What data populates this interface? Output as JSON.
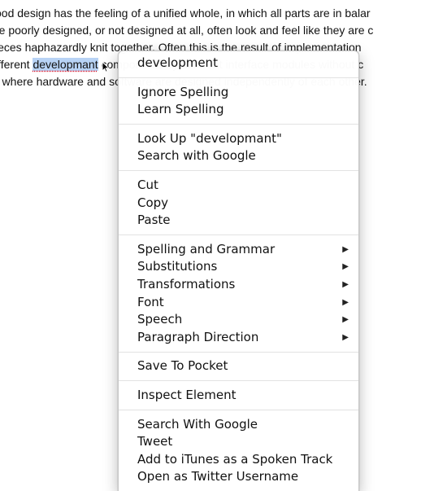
{
  "document": {
    "lines": [
      {
        "before": "ood design has the feeling of a unified whole, in which all parts are in balar",
        "word": "",
        "after": ""
      },
      {
        "before": "re poorly designed, or not designed at all, often look and feel like they are c",
        "word": "",
        "after": ""
      },
      {
        "before": "ieces haphazardly knit together. Often this is the result of implementation",
        "word": "",
        "after": ""
      },
      {
        "before": "ifferent ",
        "word": "developmant",
        "after": " components by different interface modules without c"
      },
      {
        "before": "r where hardware and software are designed independently of each other.",
        "word": "",
        "after": ""
      }
    ]
  },
  "context_menu": {
    "groups": [
      {
        "items": [
          {
            "label": "development",
            "submenu": false
          }
        ]
      },
      {
        "items": [
          {
            "label": "Ignore Spelling",
            "submenu": false
          },
          {
            "label": "Learn Spelling",
            "submenu": false
          }
        ]
      },
      {
        "items": [
          {
            "label": "Look Up \"developmant\"",
            "submenu": false
          },
          {
            "label": "Search with Google",
            "submenu": false
          }
        ]
      },
      {
        "items": [
          {
            "label": "Cut",
            "submenu": false
          },
          {
            "label": "Copy",
            "submenu": false
          },
          {
            "label": "Paste",
            "submenu": false
          }
        ]
      },
      {
        "items": [
          {
            "label": "Spelling and Grammar",
            "submenu": true
          },
          {
            "label": "Substitutions",
            "submenu": true
          },
          {
            "label": "Transformations",
            "submenu": true
          },
          {
            "label": "Font",
            "submenu": true
          },
          {
            "label": "Speech",
            "submenu": true
          },
          {
            "label": "Paragraph Direction",
            "submenu": true
          }
        ]
      },
      {
        "items": [
          {
            "label": "Save To Pocket",
            "submenu": false
          }
        ]
      },
      {
        "items": [
          {
            "label": "Inspect Element",
            "submenu": false
          }
        ]
      },
      {
        "items": [
          {
            "label": "Search With Google",
            "submenu": false
          },
          {
            "label": "Tweet",
            "submenu": false
          },
          {
            "label": "Add to iTunes as a Spoken Track",
            "submenu": false
          },
          {
            "label": "Open as Twitter Username",
            "submenu": false
          }
        ]
      }
    ],
    "submenu_arrow": "▶",
    "icons": {
      "submenu": "submenu-arrow-icon",
      "cursor": "pointer-cursor-icon"
    }
  },
  "colors": {
    "selection": "#b8d3f5",
    "spelling_underline": "#d0021b"
  }
}
